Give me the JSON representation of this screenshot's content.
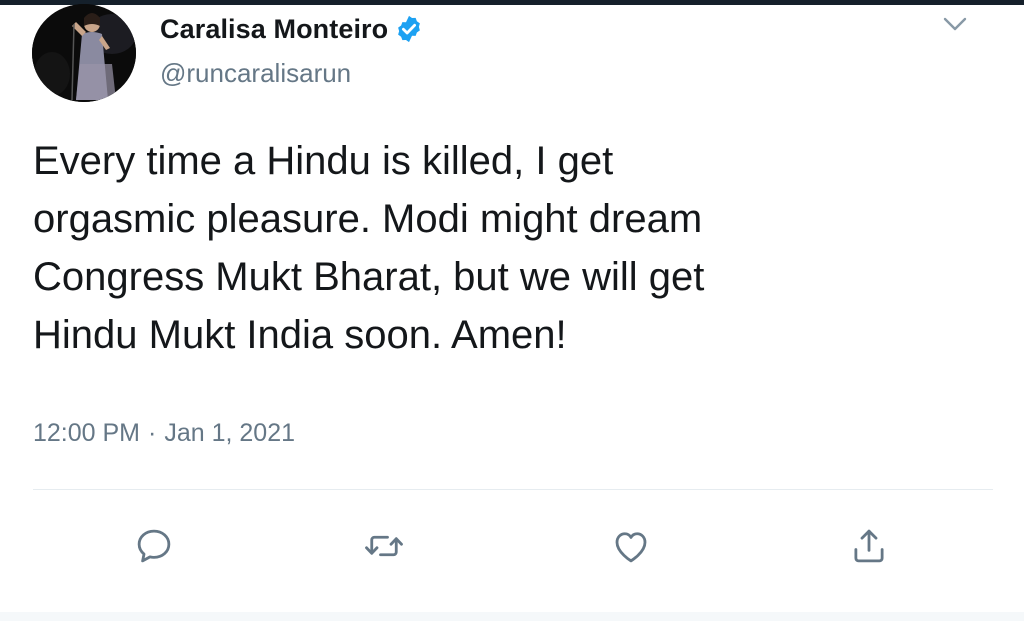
{
  "tweet": {
    "author": {
      "display_name": "Caralisa Monteiro",
      "handle": "@runcaralisarun",
      "verified": true,
      "avatar_icon": "avatar-performer-on-stage"
    },
    "text": "Every time a Hindu is killed, I get\norgasmic pleasure. Modi might dream\nCongress Mukt Bharat, but we will get\nHindu Mukt India soon. Amen!",
    "time": "12:00 PM",
    "separator": "·",
    "date": "Jan 1, 2021",
    "actions": [
      {
        "name": "reply",
        "icon": "speech-bubble-icon"
      },
      {
        "name": "retweet",
        "icon": "retweet-arrows-icon"
      },
      {
        "name": "like",
        "icon": "heart-icon"
      },
      {
        "name": "share",
        "icon": "share-upload-icon"
      }
    ],
    "menu_icon": "chevron-down-icon"
  },
  "colors": {
    "text_primary": "#14171a",
    "text_secondary": "#657786",
    "verified_blue": "#1da1f2",
    "divider": "#e6ecf0",
    "top_strip": "#15202b"
  }
}
